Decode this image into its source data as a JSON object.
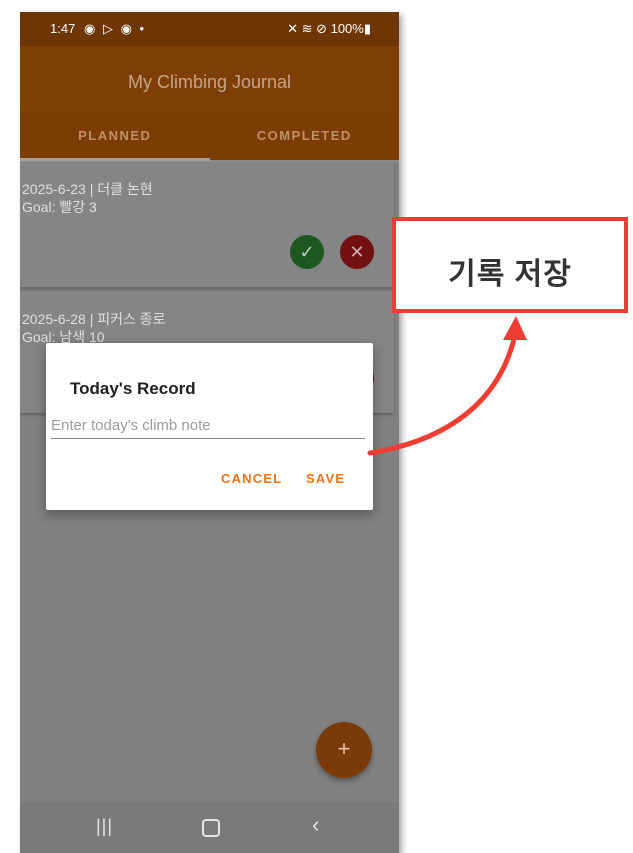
{
  "status_bar": {
    "time": "1:47",
    "left_icons": "◉ ▷ ◉ •",
    "right_icons": "✕ ≋ ⊘ 100%▮"
  },
  "app": {
    "title": "My Climbing Journal"
  },
  "tabs": [
    {
      "label": "PLANNED",
      "selected": true
    },
    {
      "label": "COMPLETED",
      "selected": false
    }
  ],
  "cards": [
    {
      "title": "2025-6-23 | 더클 논현",
      "goal": "Goal: 빨강 3"
    },
    {
      "title": "2025-6-28 | 피커스 종로",
      "goal": "Goal: 남색 10"
    }
  ],
  "icons": {
    "check": "✓",
    "close": "✕",
    "plus": "+"
  },
  "dialog": {
    "title": "Today's Record",
    "input_placeholder": "Enter today's climb note",
    "input_value": "",
    "cancel_label": "CANCEL",
    "save_label": "SAVE"
  },
  "nav": {
    "recents": "|||",
    "back": "‹"
  },
  "callout": {
    "label": "기록 저장",
    "color": "#ef3d34"
  },
  "colors": {
    "primary": "#7e3f07",
    "accent": "#e8731a",
    "success": "#1e5e21",
    "danger": "#7a1214"
  }
}
